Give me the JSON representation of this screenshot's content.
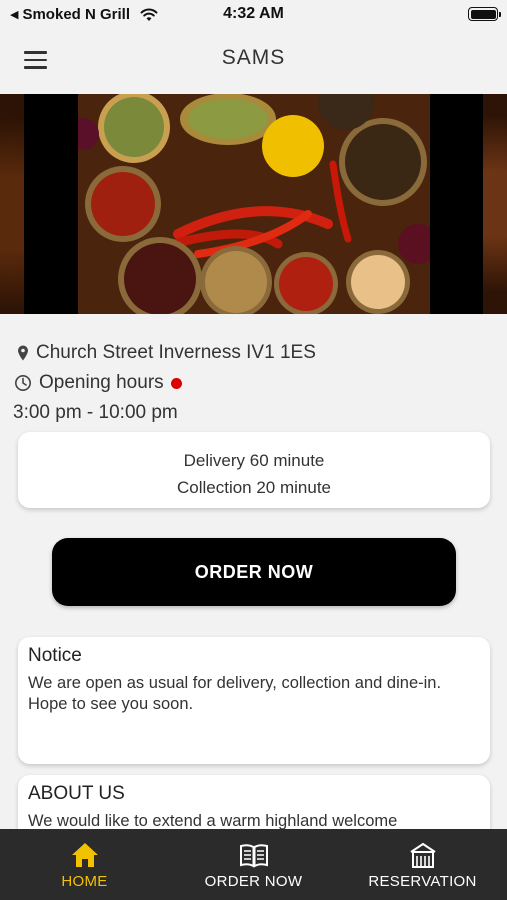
{
  "status_bar": {
    "back_app": "Smoked N Grill",
    "time": "4:32 AM"
  },
  "header": {
    "title": "SAMS"
  },
  "restaurant": {
    "address": "Church Street  Inverness  IV1 1ES",
    "opening_label": "Opening hours",
    "hours": "3:00 pm - 10:00 pm",
    "status_color": "#d90000"
  },
  "service": {
    "delivery": "Delivery 60 minute",
    "collection": "Collection 20 minute"
  },
  "order_button": {
    "label": "ORDER NOW"
  },
  "notice": {
    "title": "Notice",
    "line1": "We are open as usual for delivery, collection and dine-in.",
    "line2": "Hope to see you soon."
  },
  "about": {
    "title": "ABOUT US",
    "text": "We would like to extend a warm highland welcome"
  },
  "tabs": [
    {
      "label": "HOME",
      "icon": "home-icon",
      "active": true
    },
    {
      "label": "ORDER NOW",
      "icon": "menu-book-icon",
      "active": false
    },
    {
      "label": "RESERVATION",
      "icon": "restaurant-building-icon",
      "active": false
    }
  ],
  "colors": {
    "accent": "#f2c200",
    "tabbar": "#2b2b2b",
    "button": "#000000"
  }
}
